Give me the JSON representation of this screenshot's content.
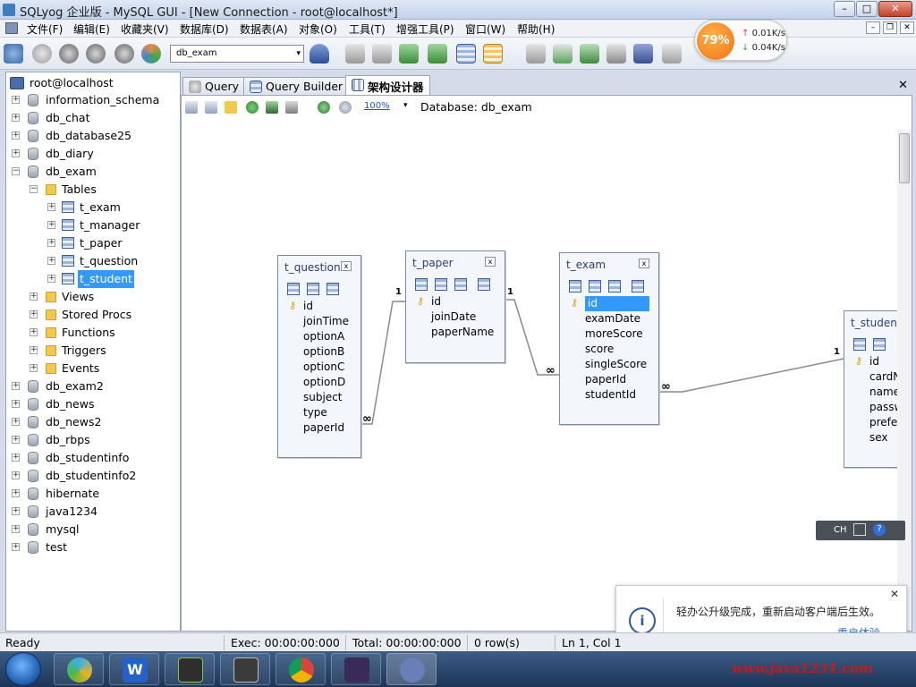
{
  "window": {
    "title": "SQLyog 企业版 - MySQL GUI - [New Connection - root@localhost*]",
    "min_label": "–",
    "max_label": "□",
    "close_label": "✕"
  },
  "menu": [
    "文件(F)",
    "编辑(E)",
    "收藏夹(V)",
    "数据库(D)",
    "数据表(A)",
    "对象(O)",
    "工具(T)",
    "增强工具(P)",
    "窗口(W)",
    "帮助(H)"
  ],
  "mdi_controls": [
    "–",
    "❐",
    "✕"
  ],
  "toolbar": {
    "db_select": "db_exam",
    "db_arrow": "▾"
  },
  "speed_widget": {
    "percent": "79%",
    "upload": "0.01K/s",
    "download": "0.04K/s",
    "up_arrow": "↑",
    "down_arrow": "↓"
  },
  "tree": {
    "root": "root@localhost",
    "nodes": {
      "information_schema": "information_schema",
      "db_chat": "db_chat",
      "db_database25": "db_database25",
      "db_diary": "db_diary",
      "db_exam": "db_exam",
      "tables_folder": "Tables",
      "t_exam": "t_exam",
      "t_manager": "t_manager",
      "t_paper": "t_paper",
      "t_question": "t_question",
      "t_student": "t_student",
      "views": "Views",
      "stored_procs": "Stored Procs",
      "functions": "Functions",
      "triggers": "Triggers",
      "events": "Events",
      "db_exam2": "db_exam2",
      "db_news": "db_news",
      "db_news2": "db_news2",
      "db_rbps": "db_rbps",
      "db_studentinfo": "db_studentinfo",
      "db_studentinfo2": "db_studentinfo2",
      "hibernate": "hibernate",
      "java1234": "java1234",
      "mysql": "mysql",
      "test": "test"
    },
    "plus": "+",
    "minus": "−"
  },
  "tabs": {
    "query": "Query",
    "query_builder": "Query Builder",
    "schema_designer": "架构设计器",
    "close": "✕"
  },
  "designer": {
    "zoom": "100%",
    "zoom_arrow": "▾",
    "database_label": "Database: db_exam",
    "tables": {
      "t_question": {
        "name": "t_question",
        "fields": [
          "id",
          "joinTime",
          "optionA",
          "optionB",
          "optionC",
          "optionD",
          "subject",
          "type",
          "paperId"
        ]
      },
      "t_paper": {
        "name": "t_paper",
        "fields": [
          "id",
          "joinDate",
          "paperName"
        ]
      },
      "t_exam": {
        "name": "t_exam",
        "fields": [
          "id",
          "examDate",
          "moreScore",
          "score",
          "singleScore",
          "paperId",
          "studentId"
        ]
      },
      "t_student": {
        "name": "t_student",
        "fields": [
          "id",
          "cardNo",
          "name",
          "password",
          "prefession",
          "sex"
        ]
      }
    },
    "rel_one": "1",
    "rel_many": "∞",
    "key_glyph": "⚷",
    "x_glyph": "x"
  },
  "ime": {
    "lang": "CH",
    "help": "?"
  },
  "notification": {
    "message": "轻办公升级完成，重新启动客户端后生效。",
    "link": "重启体验",
    "close": "✕",
    "icon_glyph": "i"
  },
  "status": {
    "ready": "Ready",
    "exec": "Exec: 00:00:00:000",
    "total": "Total: 00:00:00:000",
    "rows": "0 row(s)",
    "position": "Ln 1, Col 1"
  },
  "taskbar": {
    "watermark": "www.java1234.com",
    "w_glyph": "W"
  }
}
